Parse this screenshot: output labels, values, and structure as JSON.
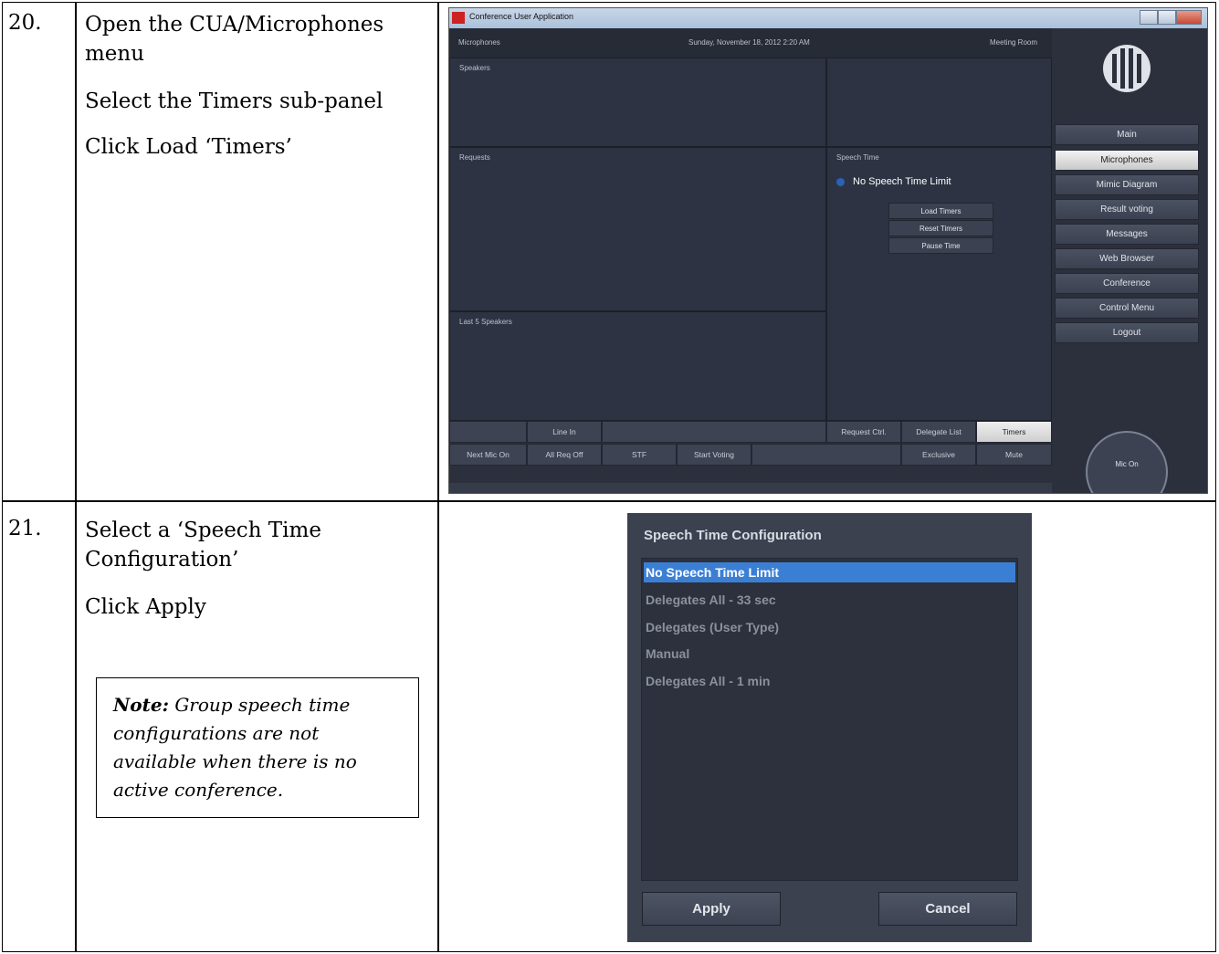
{
  "rows": [
    {
      "number": "20.",
      "instructions": [
        "Open the CUA/Microphones",
        "menu",
        "Select the Timers sub-panel",
        "Click Load ‘Timers’"
      ]
    },
    {
      "number": "21.",
      "instructions": [
        "Select a ‘Speech Time",
        "Configuration’",
        "Click Apply"
      ],
      "note": {
        "label": "Note:",
        "lines": [
          " Group speech time",
          "configurations are not",
          "available when there is no",
          "active conference."
        ]
      }
    }
  ],
  "cua": {
    "window_title": "Conference User Application",
    "header": {
      "section": "Microphones",
      "datetime": "Sunday, November 18, 2012 2:20 AM",
      "room": "Meeting Room"
    },
    "panels": {
      "speakers": "Speakers",
      "requests": "Requests",
      "last_speakers": "Last 5 Speakers",
      "speech_time": "Speech Time"
    },
    "speech_time_value": "No Speech Time Limit",
    "timer_buttons": [
      "Load Timers",
      "Reset Timers",
      "Pause Time"
    ],
    "side_menu": [
      "Main",
      "Microphones",
      "Mimic Diagram",
      "Result voting",
      "Messages",
      "Web Browser",
      "Conference",
      "Control Menu",
      "Logout"
    ],
    "active_side_menu": "Microphones",
    "bar_row1": [
      "Line In",
      "Request Ctrl.",
      "Delegate List",
      "Timers"
    ],
    "bar_row2": [
      "Next Mic On",
      "All Req Off",
      "STF",
      "Start Voting",
      "Exclusive",
      "Mute"
    ],
    "mic_button": "Mic On",
    "colors": {
      "background": "#2b303c",
      "selected": "#3b7fd5"
    }
  },
  "dialog": {
    "title": "Speech Time Configuration",
    "options": [
      "No Speech Time Limit",
      "Delegates All - 33 sec",
      "Delegates (User Type)",
      "Manual",
      "Delegates All - 1 min"
    ],
    "selected_index": 0,
    "apply_label": "Apply",
    "cancel_label": "Cancel"
  }
}
